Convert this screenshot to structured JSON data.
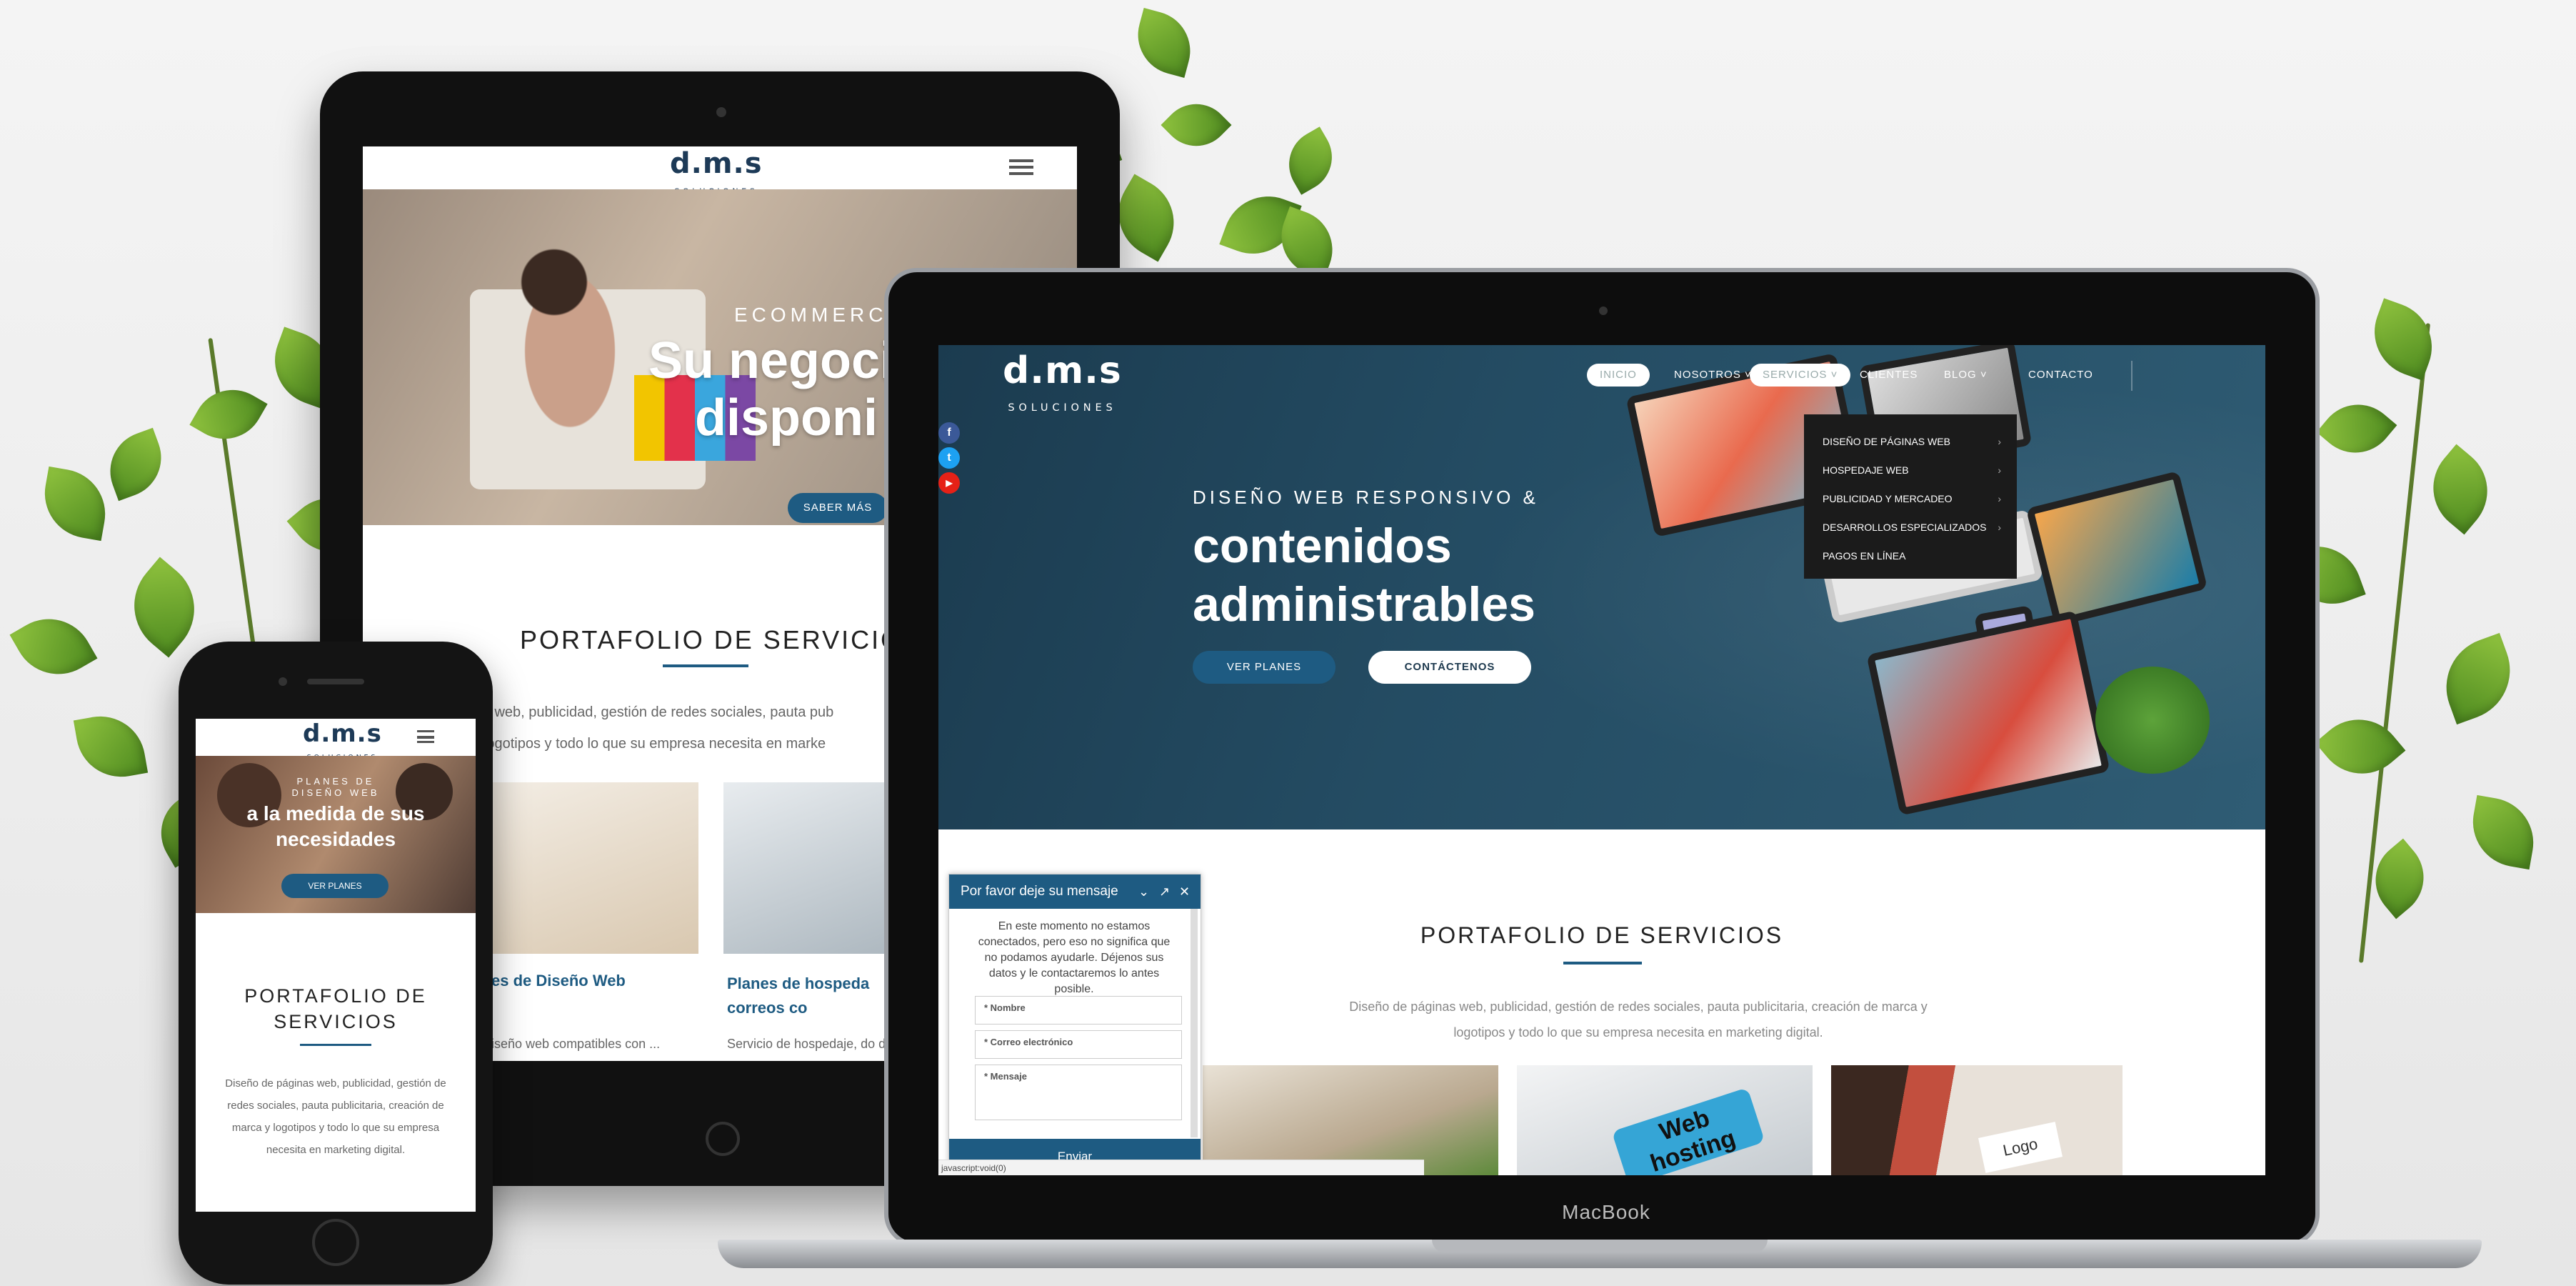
{
  "brand": {
    "logo": "d.m.s",
    "logo_sub": "SOLUCIONES",
    "accent": "#1e5b82"
  },
  "tablet": {
    "eyebrow": "ECOMMERCE, TI",
    "title_l1": "Su negoci",
    "title_l2": "disponi",
    "cta": "SABER MÁS",
    "portfolio_title": "PORTAFOLIO DE SERVICIOS",
    "portfolio_desc_l1": "áginas web, publicidad, gestión de redes sociales, pauta pub",
    "portfolio_desc_l2": "rca y logotipos y todo lo que su empresa necesita en marke",
    "card1_title": "es de Diseño Web",
    "card2_title": "Planes de hospeda correos co",
    "card1_body": "iseño web compatibles con ... contenidos administrables ... programación",
    "card2_body": "Servicio de hospedaje, do de correos corporativos.",
    "chat_fragment": "ensaje"
  },
  "phone": {
    "eyebrow_l1": "PLANES DE",
    "eyebrow_l2": "DISEÑO WEB",
    "title": "a la medida de sus necesidades",
    "cta": "VER PLANES",
    "portfolio_title": "PORTAFOLIO DE SERVICIOS",
    "portfolio_desc": "Diseño de páginas web, publicidad, gestión de redes sociales, pauta publicitaria, creación de marca y logotipos y todo lo que su empresa necesita en marketing digital."
  },
  "laptop": {
    "device_label": "MacBook",
    "nav": [
      "INICIO",
      "NOSOTROS ˅",
      "SERVICIOS ˅",
      "CLIENTES",
      "BLOG ˅",
      "CONTACTO"
    ],
    "dropdown": [
      "DISEÑO DE PÁGINAS WEB",
      "HOSPEDAJE WEB",
      "PUBLICIDAD Y MERCADEO",
      "DESARROLLOS ESPECIALIZADOS",
      "PAGOS EN LÍNEA"
    ],
    "social": [
      "f",
      "t",
      "▶"
    ],
    "eyebrow": "DISEÑO WEB RESPONSIVO &",
    "title_l1": "contenidos",
    "title_l2": "administrables",
    "btn_plans": "VER PLANES",
    "btn_contact": "CONTÁCTENOS",
    "portfolio_title": "PORTAFOLIO DE SERVICIOS",
    "portfolio_desc_l1": "Diseño de páginas web, publicidad, gestión de redes sociales, pauta publicitaria, creación de marca y",
    "portfolio_desc_l2": "logotipos y todo lo que su empresa necesita en marketing digital.",
    "img2_text": "Web hosting",
    "img3_text": "Logo",
    "status_url": "javascript:void(0)"
  },
  "chat": {
    "title": "Por favor deje su mensaje",
    "message": "En este momento no estamos conectados, pero eso no significa que no podamos ayudarle. Déjenos sus datos y le contactaremos lo antes posible.",
    "name_placeholder": "* Nombre",
    "email_placeholder": "* Correo electrónico",
    "msg_placeholder": "* Mensaje",
    "send": "Enviar"
  }
}
